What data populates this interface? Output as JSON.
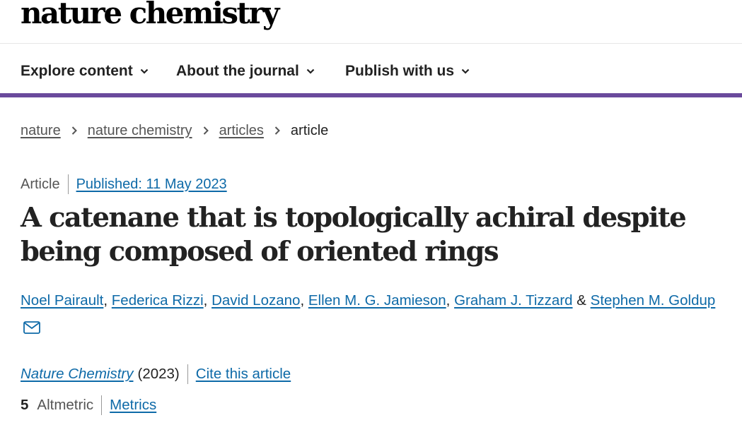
{
  "logo": {
    "text": "nature chemistry"
  },
  "nav": {
    "items": [
      {
        "label": "Explore content",
        "icon": "chevron-down-icon"
      },
      {
        "label": "About the journal",
        "icon": "chevron-down-icon"
      },
      {
        "label": "Publish with us",
        "icon": "chevron-down-icon"
      }
    ],
    "accent_color": "#6a4a9c"
  },
  "breadcrumb": {
    "items": [
      "nature",
      "nature chemistry",
      "articles"
    ],
    "current": "article"
  },
  "article": {
    "type": "Article",
    "published": "Published: 11 May 2023",
    "title": "A catenane that is topologically achiral despite being composed of oriented rings",
    "authors": [
      "Noel Pairault",
      "Federica Rizzi",
      "David Lozano",
      "Ellen M. G. Jamieson",
      "Graham J. Tizzard",
      "Stephen M. Goldup"
    ],
    "author_sep": ",",
    "author_and": "&",
    "contact_icon": "mail-icon",
    "journal": "Nature Chemistry",
    "year": "(2023)",
    "cite_label": "Cite this article",
    "altmetric_count": "5",
    "altmetric_label": "Altmetric",
    "metrics_label": "Metrics"
  },
  "colors": {
    "link": "#0e6aa8",
    "text": "#222222",
    "muted": "#555555"
  }
}
